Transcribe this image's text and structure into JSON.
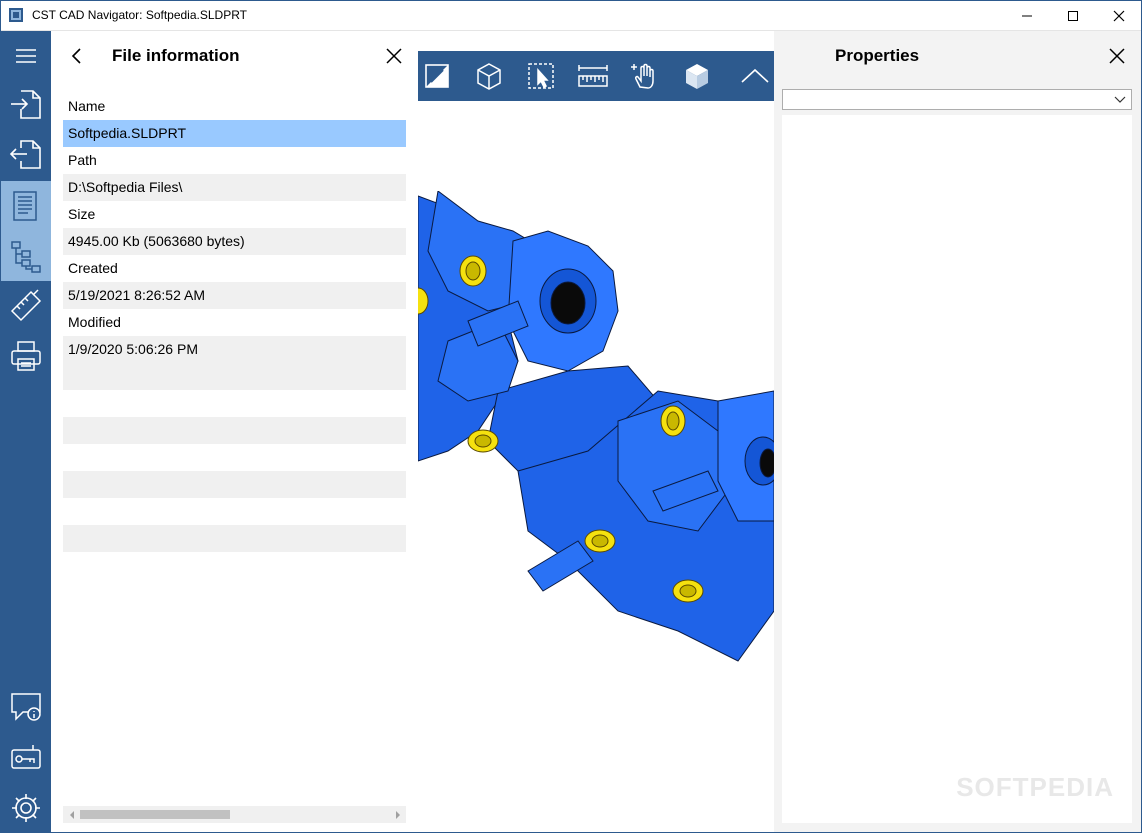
{
  "window": {
    "title": "CST CAD Navigator: Softpedia.SLDPRT",
    "controls": [
      "minimize",
      "maximize",
      "close"
    ]
  },
  "rail": {
    "items": [
      {
        "icon": "hamburger-menu-icon"
      },
      {
        "icon": "import-file-icon"
      },
      {
        "icon": "export-file-icon"
      },
      {
        "icon": "file-information-icon",
        "active": true
      },
      {
        "icon": "structure-tree-icon",
        "active": true
      },
      {
        "icon": "measure-ruler-icon"
      },
      {
        "icon": "printer-icon"
      },
      {
        "icon": "feedback-chat-icon"
      },
      {
        "icon": "license-key-icon"
      },
      {
        "icon": "settings-gear-icon"
      }
    ]
  },
  "file_panel": {
    "title": "File information",
    "rows": [
      {
        "text": "Name",
        "kind": "label"
      },
      {
        "text": "Softpedia.SLDPRT",
        "kind": "selected"
      },
      {
        "text": "Path",
        "kind": "label"
      },
      {
        "text": "D:\\Softpedia Files\\",
        "kind": "value"
      },
      {
        "text": "Size",
        "kind": "label"
      },
      {
        "text": "4945.00 Kb (5063680 bytes)",
        "kind": "value"
      },
      {
        "text": "Created",
        "kind": "label"
      },
      {
        "text": "5/19/2021 8:26:52 AM",
        "kind": "value"
      },
      {
        "text": "Modified",
        "kind": "label"
      },
      {
        "text": "1/9/2020 5:06:26 PM",
        "kind": "value"
      },
      {
        "text": "",
        "kind": "value"
      },
      {
        "text": "",
        "kind": "label"
      },
      {
        "text": "",
        "kind": "value"
      },
      {
        "text": "",
        "kind": "label"
      },
      {
        "text": "",
        "kind": "value"
      },
      {
        "text": "",
        "kind": "label"
      },
      {
        "text": "",
        "kind": "value"
      },
      {
        "text": "",
        "kind": "label"
      }
    ]
  },
  "viewport_toolbar": {
    "tools": [
      "section-view-icon",
      "cube-wireframe-icon",
      "select-pointer-icon",
      "ruler-measure-icon",
      "pan-hand-icon",
      "shaded-cube-icon",
      "collapse-toolbar-icon"
    ]
  },
  "properties_panel": {
    "title": "Properties",
    "selected_value": ""
  },
  "watermark": "SOFTPEDIA",
  "colors": {
    "accent": "#2d5a8e",
    "rail_active": "#8fb6dd",
    "selection": "#99c9ff",
    "model_blue": "#1f63e8",
    "model_yellow": "#f5e10f"
  }
}
